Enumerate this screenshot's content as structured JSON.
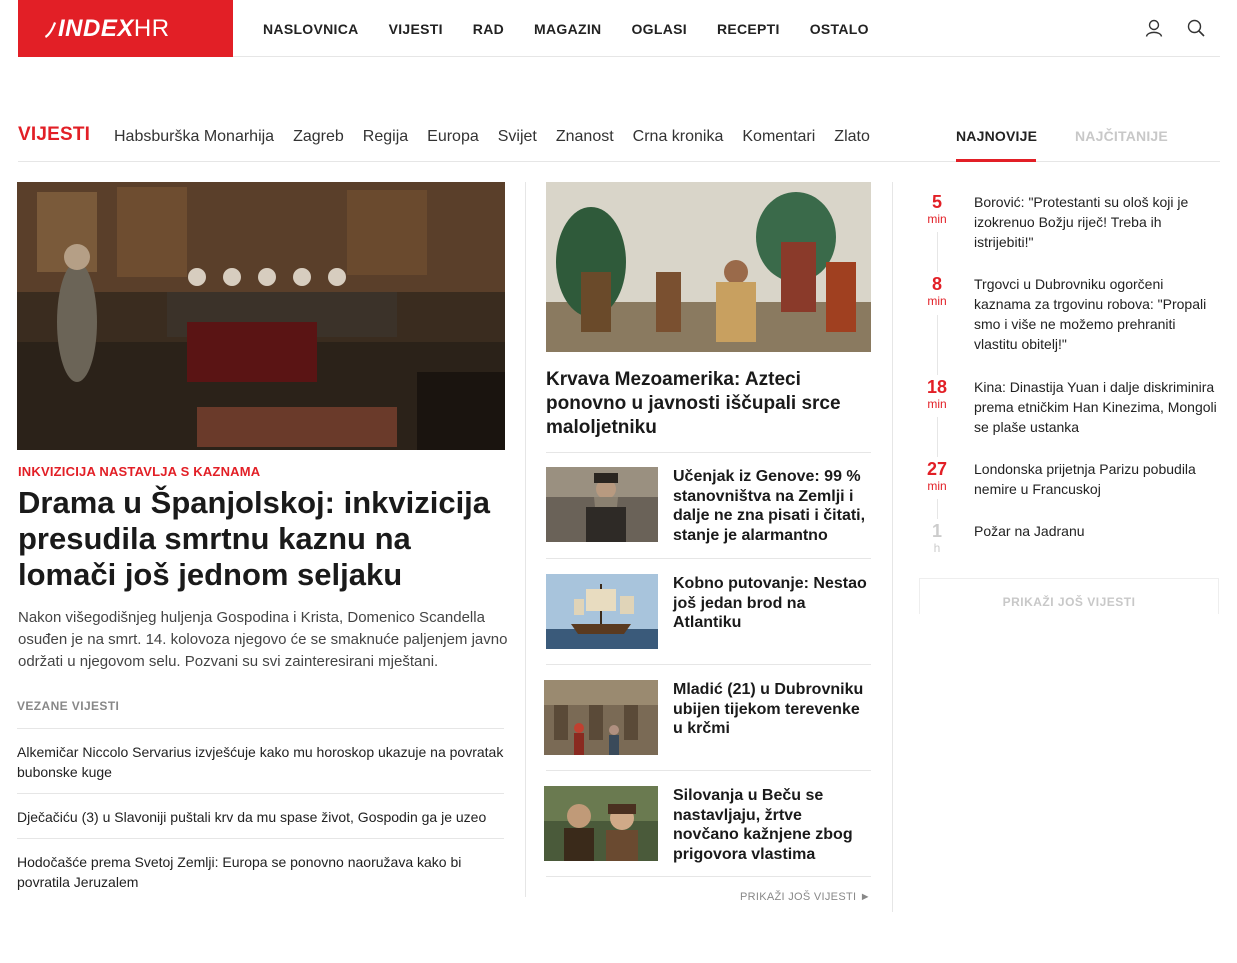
{
  "header": {
    "logo_text": "INDEX",
    "logo_suffix": "HR",
    "nav": [
      "NASLOVNICA",
      "VIJESTI",
      "RAD",
      "MAGAZIN",
      "OGLASI",
      "RECEPTI",
      "OSTALO"
    ],
    "icons": [
      "user-icon",
      "search-icon"
    ]
  },
  "section": {
    "title": "VIJESTI",
    "subsections": [
      "Habsburška Monarhija",
      "Zagreb",
      "Regija",
      "Europa",
      "Svijet",
      "Znanost",
      "Crna kronika",
      "Komentari",
      "Zlato"
    ],
    "tabs": [
      "NAJNOVIJE",
      "NAJČITANIJE"
    ]
  },
  "lead": {
    "kicker": "INKVIZICIJA NASTAVLJA S KAZNAMA",
    "title": "Drama u Španjolskoj: inkvizicija presudila smrtnu kaznu na lomači još jednom seljaku",
    "description": "Nakon višegodišnjeg huljenja Gospodina i Krista, Domenico Scandella osuđen je na smrt. 14. kolovoza njegovo će se smaknuće paljenjem javno održati u njegovom selu. Pozvani su svi zainteresirani mještani.",
    "related_label": "VEZANE VIJESTI",
    "related": [
      "Alkemičar Niccolo Servarius izvješćuje kako mu horoskop ukazuje na povratak bubonske kuge",
      "Dječačiću (3) u Slavoniji puštali krv da mu spase život, Gospodin ga je uzeo",
      "Hodočašće prema Svetoj Zemlji: Europa se ponovno naoružava kako bi povratila Jeruzalem"
    ]
  },
  "middle": {
    "main_title": "Krvava Mezoamerika: Azteci ponovno u javnosti iščupali srce maloljetniku",
    "items": [
      "Učenjak iz Genove: 99 % stanovništva na Zemlji i dalje ne zna pisati i čitati, stanje je alarmantno",
      "Kobno putovanje: Nestao još jedan brod na Atlantiku",
      "Mladić (21) u Dubrovniku ubijen tijekom terevenke u krčmi",
      "Silovanja u Beču se nastavljaju, žrtve novčano kažnjene zbog prigovora vlastima"
    ],
    "more": "PRIKAŽI JOŠ VIJESTI ►"
  },
  "latest": {
    "items": [
      {
        "num": "5",
        "unit": "min",
        "text": "Borović: \"Protestanti su ološ koji je izokrenuo Božju riječ! Treba ih istrijebiti!\""
      },
      {
        "num": "8",
        "unit": "min",
        "text": "Trgovci u Dubrovniku ogorčeni kaznama za trgovinu robova: \"Propali smo i više ne možemo prehraniti vlastitu obitelj!\""
      },
      {
        "num": "18",
        "unit": "min",
        "text": "Kina: Dinastija Yuan i dalje diskriminira prema etničkim Han Kinezima, Mongoli se plaše ustanka"
      },
      {
        "num": "27",
        "unit": "min",
        "text": "Londonska prijetnja Parizu pobudila nemire u Francuskoj"
      },
      {
        "num": "1",
        "unit": "h",
        "text": "Požar na Jadranu"
      }
    ],
    "more": "PRIKAŽI JOŠ VIJESTI"
  },
  "colors": {
    "accent": "#e21f26",
    "muted": "#c8c8c8",
    "text": "#222222"
  }
}
